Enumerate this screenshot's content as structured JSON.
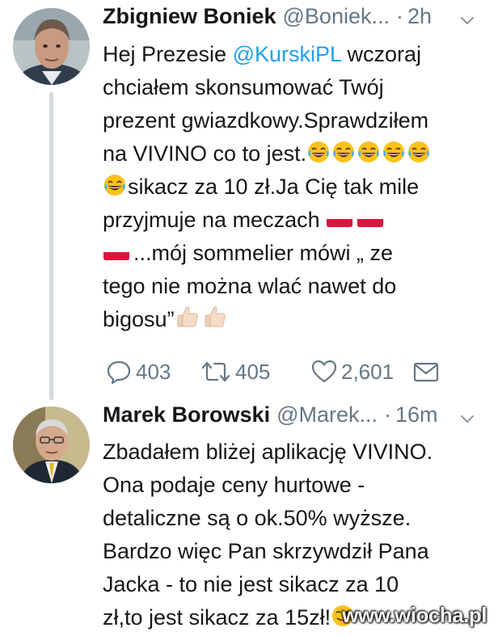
{
  "tweets": [
    {
      "author": {
        "name": "Zbigniew Boniek",
        "handle": "@Boniek...",
        "time": "2h",
        "separator": "·"
      },
      "body": {
        "l1a": "Hej Prezesie ",
        "l1mention": "@KurskiPL",
        "l1b": " wczoraj",
        "l2": "chciałem skonsumować Twój",
        "l3": "prezent gwiazdkowy.Sprawdziłem",
        "l4": "na VIVINO co to jest.",
        "l5": "sikacz za 10 zł.Ja Cię tak mile",
        "l6": "przyjmuje na meczach ",
        "l7": "...mój  sommelier mówi „ ze",
        "l8": "tego nie można wlać nawet do",
        "l9": "bigosu”"
      },
      "emoji_names": [
        "face-with-tears-of-joy",
        "flag-poland",
        "thumbs-up-light-skin"
      ],
      "actions": {
        "replies": "403",
        "retweets": "405",
        "likes": "2,601"
      }
    },
    {
      "author": {
        "name": "Marek Borowski",
        "handle": "@Marek...",
        "time": "16m",
        "separator": "·"
      },
      "body": {
        "l1": "Zbadałem bliżej aplikację VIVINO.",
        "l2": "Ona podaje ceny hurtowe -",
        "l3": "detaliczne są o ok.50% wyższe.",
        "l4": "Bardzo więc Pan skrzywdził Pana",
        "l5": "Jacka - to nie jest sikacz za 10",
        "l6": "zł,to jest sikacz za 15zł!"
      },
      "emoji_names": [
        "winking-face-with-tongue"
      ]
    }
  ],
  "watermark": "www.wiocha.pl",
  "colors": {
    "text": "#14171a",
    "secondary": "#657786",
    "link": "#1da1f2",
    "thread_line": "#d2d9df"
  }
}
